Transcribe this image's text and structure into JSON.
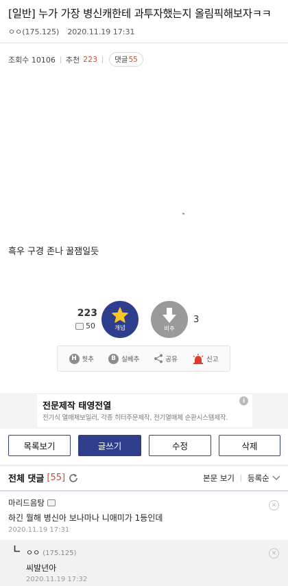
{
  "post": {
    "title": "[일반] 누가 가장 병신캐한테 과투자했는지 올림픽해보자ㅋㅋ",
    "author": "ㅇㅇ(175.125)",
    "date": "2020.11.19 17:31",
    "views_label": "조회수 10106",
    "rec_label": "추천",
    "rec_value": "223",
    "comments_label": "댓글",
    "comments_value": "55",
    "body": "흑우 구경 존나 꿀잼일듯"
  },
  "vote": {
    "rec_count": "223",
    "fixed_count": "50",
    "up_label": "개념",
    "down_label": "비추",
    "nonrec_count": "3"
  },
  "actions": {
    "hit": "힛추",
    "best": "실베추",
    "share": "공유",
    "report": "신고"
  },
  "ad": {
    "title": "전문제작 태영전열",
    "subtitle": "전기식 열매체보일러, 각종 히터주문제작, 전기열매체 순환시스템제작."
  },
  "buttons": {
    "list": "목록보기",
    "write": "글쓰기",
    "edit": "수정",
    "delete": "삭제"
  },
  "comments": {
    "header": "전체 댓글",
    "count": "[55]",
    "view_body": "본문 보기",
    "sort": "등록순",
    "items": [
      {
        "name": "마리드음탕",
        "text": "하긴 뭘해 병신아 보나마나 니애미가 1등인데",
        "date": "2020.11.19 17:31"
      },
      {
        "name": "ㅇㅇ",
        "ip": "(175.125)",
        "text": "씨발년아",
        "date": "2020.11.19 17:32"
      }
    ]
  },
  "colors": {
    "brand": "#2e3e8c",
    "accent_red": "#d04a34",
    "star": "#f7c525"
  }
}
